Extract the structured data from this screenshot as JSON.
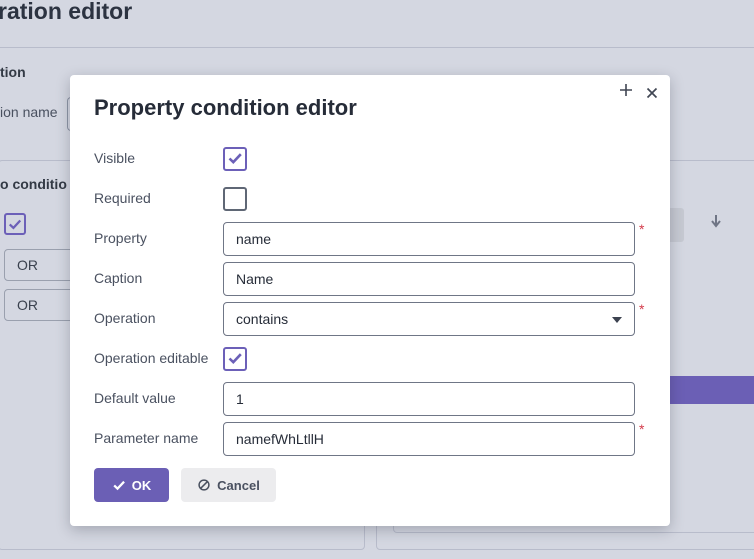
{
  "background": {
    "title": "ration editor",
    "section_label": "tion",
    "name_label": "ion name",
    "group_label": "o conditio",
    "or_items": [
      "OR",
      "OR"
    ]
  },
  "dialog": {
    "title": "Property condition editor",
    "fields": {
      "visible": {
        "label": "Visible",
        "checked": true
      },
      "required": {
        "label": "Required",
        "checked": false
      },
      "property": {
        "label": "Property",
        "value": "name",
        "required": true
      },
      "caption": {
        "label": "Caption",
        "value": "Name"
      },
      "operation": {
        "label": "Operation",
        "value": "contains",
        "required": true
      },
      "operation_editable": {
        "label": "Operation editable",
        "checked": true
      },
      "default_value": {
        "label": "Default value",
        "value": "1"
      },
      "parameter_name": {
        "label": "Parameter name",
        "value": "namefWhLtllH",
        "required": true
      }
    },
    "required_marker": "*",
    "buttons": {
      "ok": "OK",
      "cancel": "Cancel"
    }
  },
  "colors": {
    "accent": "#6b5fb5",
    "required": "#d33a4a",
    "overlay": "#d4d7e1"
  },
  "icons": [
    "maximize-icon",
    "close-icon",
    "check-icon",
    "cancel-icon",
    "chevron-down-icon",
    "arrow-down-icon"
  ]
}
